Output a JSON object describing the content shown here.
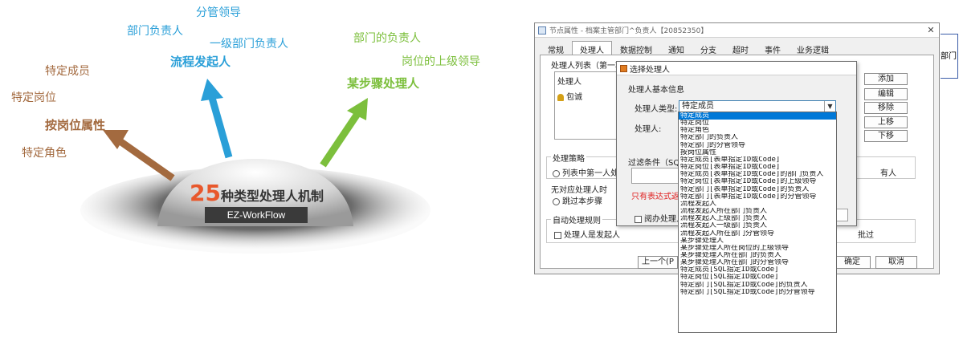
{
  "infographic": {
    "labels_left": [
      "特定成员",
      "特定岗位",
      "按岗位属性",
      "特定角色"
    ],
    "labels_blue": [
      "分管领导",
      "部门负责人",
      "一级部门负责人",
      "流程发起人"
    ],
    "labels_green": [
      "部门的负责人",
      "岗位的上级领导",
      "某步骤处理人"
    ],
    "dome_number": "25",
    "dome_text": "种类型处理人机制",
    "dome_badge": "EZ-WorkFlow",
    "colors": {
      "brown": "#a36a3f",
      "blue": "#2a9fd8",
      "green": "#7cbf3c",
      "number": "#e8582c"
    }
  },
  "window": {
    "title": "节点属性 - 档案主管部门^负责人【20852350】",
    "tabs": [
      "常规",
      "处理人",
      "数据控制",
      "通知",
      "分支",
      "超时",
      "事件",
      "业务逻辑"
    ],
    "active_tab": "处理人",
    "handler_list_label": "处理人列表（第一项",
    "handler_header": "处理人",
    "handler_item": "包诚",
    "side_buttons": [
      "添加",
      "编辑",
      "移除",
      "上移",
      "下移"
    ],
    "strategy_label": "处理策略",
    "strategy_option": "列表中第一人处",
    "strategy_right": "有人",
    "no_handler_label": "无对应处理人时",
    "skip_option": "跳过本步骤",
    "auto_rules_label": "自动处理规则",
    "auto_checkbox": "处理人是发起人",
    "auto_right": "批过",
    "prev_button": "上一个(P",
    "ok_button": "确定",
    "cancel_button": "取消",
    "ext_text": "部门"
  },
  "dialog": {
    "title": "选择处理人",
    "basic_info_label": "处理人基本信息",
    "type_label": "处理人类型:",
    "type_value": "特定成员",
    "handler_label": "处理人:",
    "filter_label": "过滤条件（SQL",
    "red_hint": "只有表达式返回",
    "read_checkbox": "阅办处理人"
  },
  "dropdown": {
    "selected_index": 0,
    "options": [
      "特定成员",
      "特定岗位",
      "特定角色",
      "特定部门的负责人",
      "特定部门的分管领导",
      "按岗位属性",
      "特定成员[表单指定ID或Code]",
      "特定岗位[表单指定ID或Code]",
      "特定成员[表单指定ID或Code]的部门负责人",
      "特定岗位[表单指定ID或Code]的上级领导",
      "特定部门[表单指定ID或Code]的负责人",
      "特定部门[表单指定ID或Code]的分管领导",
      "流程发起人",
      "流程发起人所在部门负责人",
      "流程发起人上级部门负责人",
      "流程发起人一级部门负责人",
      "流程发起人所在部门分管领导",
      "某步骤处理人",
      "某步骤处理人所在岗位的上级领导",
      "某步骤处理人所在部门的负责人",
      "某步骤处理人所在部门的分管领导",
      "特定成员[SQL指定ID或Code]",
      "特定岗位[SQL指定ID或Code]",
      "特定部门[SQL指定ID或Code]的负责人",
      "特定部门[SQL指定ID或Code]的分管领导"
    ]
  }
}
